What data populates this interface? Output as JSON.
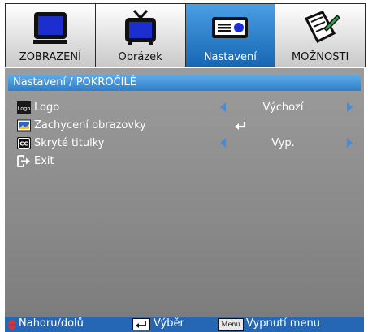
{
  "tabs": [
    {
      "label": "ZOBRAZENÍ",
      "icon": "display-icon",
      "active": false
    },
    {
      "label": "Obrázek",
      "icon": "tv-icon",
      "active": false
    },
    {
      "label": "Nastavení",
      "icon": "projector-icon",
      "active": true
    },
    {
      "label": "MOŽNOSTI",
      "icon": "notepad-icon",
      "active": false
    }
  ],
  "breadcrumb": "Nastavení / POKROČILÉ",
  "rows": [
    {
      "label": "Logo",
      "icon_text": "Logo",
      "value": "Výchozí"
    },
    {
      "label": "Zachycení obrazovky"
    },
    {
      "label": "Skryté titulky",
      "icon_text": "CC",
      "value": "Vyp."
    },
    {
      "label": "Exit"
    }
  ],
  "status": {
    "nav": "Nahoru/dolů",
    "select": "Výběr",
    "menu_key": "Menu",
    "menu": "Vypnutí menu"
  },
  "colors": {
    "accent": "#2567b4",
    "arrow": "#3d8ee0"
  }
}
